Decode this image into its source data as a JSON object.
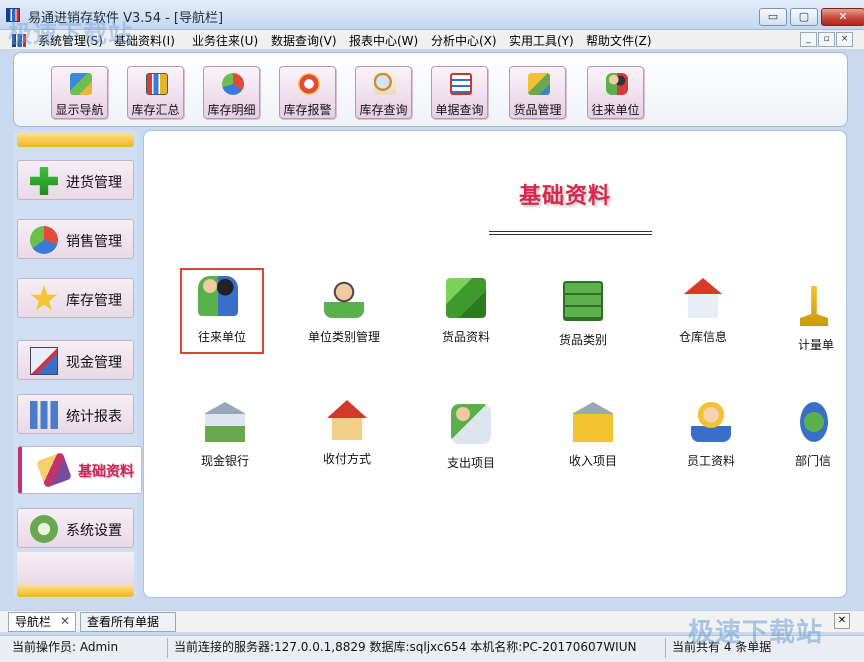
{
  "window": {
    "title": "易通进销存软件 V3.54 - [导航栏]",
    "minimize_glyph": "▭",
    "maximize_glyph": "▢",
    "close_glyph": "✕",
    "mdi_minimize_glyph": "_",
    "mdi_restore_glyph": "▫",
    "mdi_close_glyph": "×"
  },
  "menubar": {
    "items": [
      {
        "label": "系统管理(S)"
      },
      {
        "label": "基础资料(I)"
      },
      {
        "label": "业务往来(U)"
      },
      {
        "label": "数据查询(V)"
      },
      {
        "label": "报表中心(W)"
      },
      {
        "label": "分析中心(X)"
      },
      {
        "label": "实用工具(Y)"
      },
      {
        "label": "帮助文件(Z)"
      }
    ]
  },
  "watermark": {
    "top_left": "极速下载站",
    "bottom_right": "极速下载站"
  },
  "toolbar": {
    "buttons": [
      {
        "label": "显示导航",
        "icon": "navigation-grid-icon"
      },
      {
        "label": "库存汇总",
        "icon": "bar-chart-icon"
      },
      {
        "label": "库存明细",
        "icon": "pie-chart-icon"
      },
      {
        "label": "库存报警",
        "icon": "alarm-icon"
      },
      {
        "label": "库存查询",
        "icon": "magnifier-icon"
      },
      {
        "label": "单据查询",
        "icon": "document-table-icon"
      },
      {
        "label": "货品管理",
        "icon": "goods-icon"
      },
      {
        "label": "往来单位",
        "icon": "contacts-icon"
      }
    ]
  },
  "nav": {
    "items": [
      {
        "label": "进货管理",
        "icon": "plus-icon"
      },
      {
        "label": "销售管理",
        "icon": "pie-icon"
      },
      {
        "label": "库存管理",
        "icon": "star-icon"
      },
      {
        "label": "现金管理",
        "icon": "cash-icon"
      },
      {
        "label": "统计报表",
        "icon": "bars-icon"
      },
      {
        "label": "基础资料",
        "icon": "brush-icon",
        "active": true
      },
      {
        "label": "系统设置",
        "icon": "gear-icon"
      }
    ]
  },
  "content": {
    "title": "基础资料",
    "items": [
      {
        "label": "往来单位",
        "icon": "contacts-icon",
        "selected": true
      },
      {
        "label": "单位类别管理",
        "icon": "headset-person-icon"
      },
      {
        "label": "货品资料",
        "icon": "green-cubes-icon"
      },
      {
        "label": "货品类别",
        "icon": "cabinet-icon"
      },
      {
        "label": "仓库信息",
        "icon": "house-icon"
      },
      {
        "label": "计量单",
        "icon": "scale-icon"
      },
      {
        "label": "现金银行",
        "icon": "bank-coins-icon"
      },
      {
        "label": "收付方式",
        "icon": "house-arrow-icon"
      },
      {
        "label": "支出项目",
        "icon": "people-printer-icon"
      },
      {
        "label": "收入项目",
        "icon": "bank-document-icon"
      },
      {
        "label": "员工资料",
        "icon": "woman-icon"
      },
      {
        "label": "部门信",
        "icon": "globe-people-icon"
      }
    ]
  },
  "tabs": {
    "items": [
      {
        "label": "导航栏",
        "active": true
      },
      {
        "label": "查看所有单据",
        "active": false
      }
    ],
    "close_glyph": "✕",
    "strip_close_glyph": "✕"
  },
  "status": {
    "operator": "当前操作员: Admin",
    "server": "当前连接的服务器:127.0.0.1,8829 数据库:sqljxc654 本机名称:PC-20170607WIUN",
    "records": "当前共有 4 条单据"
  },
  "colors": {
    "accent_title": "#d8274e",
    "toolbar_button": "#e6cfe3",
    "nav_bar_gold": "#f3b325",
    "selection_border": "#d9453a"
  }
}
